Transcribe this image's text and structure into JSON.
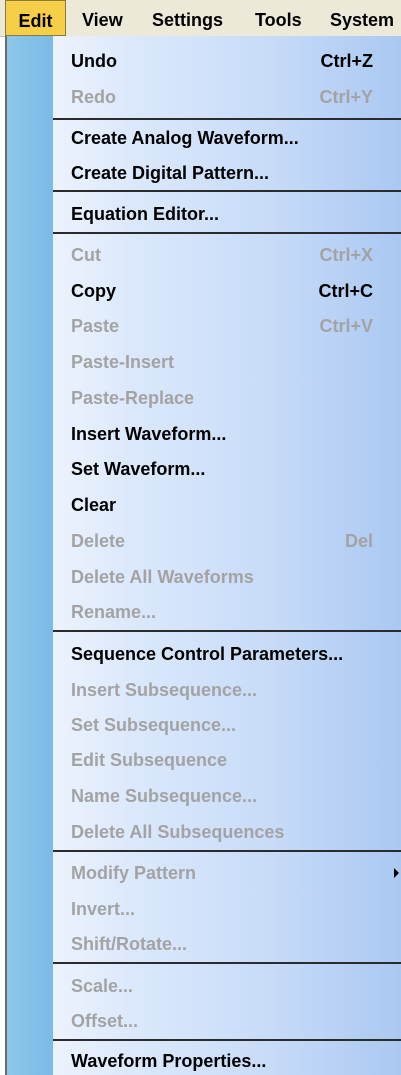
{
  "menubar": {
    "items": [
      "Edit",
      "View",
      "Settings",
      "Tools",
      "System"
    ],
    "active": "Edit"
  },
  "edit_menu": {
    "items": [
      {
        "label": "Undo",
        "shortcut": "Ctrl+Z",
        "enabled": true
      },
      {
        "label": "Redo",
        "shortcut": "Ctrl+Y",
        "enabled": false
      },
      {
        "label": "Create Analog Waveform...",
        "shortcut": "",
        "enabled": true
      },
      {
        "label": "Create Digital Pattern...",
        "shortcut": "",
        "enabled": true
      },
      {
        "label": "Equation Editor...",
        "shortcut": "",
        "enabled": true
      },
      {
        "label": "Cut",
        "shortcut": "Ctrl+X",
        "enabled": false
      },
      {
        "label": "Copy",
        "shortcut": "Ctrl+C",
        "enabled": true
      },
      {
        "label": "Paste",
        "shortcut": "Ctrl+V",
        "enabled": false
      },
      {
        "label": "Paste-Insert",
        "shortcut": "",
        "enabled": false
      },
      {
        "label": "Paste-Replace",
        "shortcut": "",
        "enabled": false
      },
      {
        "label": "Insert Waveform...",
        "shortcut": "",
        "enabled": true
      },
      {
        "label": "Set Waveform...",
        "shortcut": "",
        "enabled": true
      },
      {
        "label": "Clear",
        "shortcut": "",
        "enabled": true
      },
      {
        "label": "Delete",
        "shortcut": "Del",
        "enabled": false
      },
      {
        "label": "Delete All Waveforms",
        "shortcut": "",
        "enabled": false
      },
      {
        "label": "Rename...",
        "shortcut": "",
        "enabled": false
      },
      {
        "label": "Sequence Control Parameters...",
        "shortcut": "",
        "enabled": true
      },
      {
        "label": "Insert Subsequence...",
        "shortcut": "",
        "enabled": false
      },
      {
        "label": "Set Subsequence...",
        "shortcut": "",
        "enabled": false
      },
      {
        "label": "Edit Subsequence",
        "shortcut": "",
        "enabled": false
      },
      {
        "label": "Name Subsequence...",
        "shortcut": "",
        "enabled": false
      },
      {
        "label": "Delete All Subsequences",
        "shortcut": "",
        "enabled": false
      },
      {
        "label": "Modify Pattern",
        "shortcut": "",
        "enabled": false,
        "submenu": true
      },
      {
        "label": "Invert...",
        "shortcut": "",
        "enabled": false
      },
      {
        "label": "Shift/Rotate...",
        "shortcut": "",
        "enabled": false
      },
      {
        "label": "Scale...",
        "shortcut": "",
        "enabled": false
      },
      {
        "label": "Offset...",
        "shortcut": "",
        "enabled": false
      },
      {
        "label": "Waveform Properties...",
        "shortcut": "",
        "enabled": true
      }
    ]
  },
  "colors": {
    "menubar": "#ece9d8",
    "active_menu": "#f7ce48",
    "gutter": "#82c0e8",
    "disabled_text": "#a3a3a3",
    "enabled_text": "#000000"
  }
}
